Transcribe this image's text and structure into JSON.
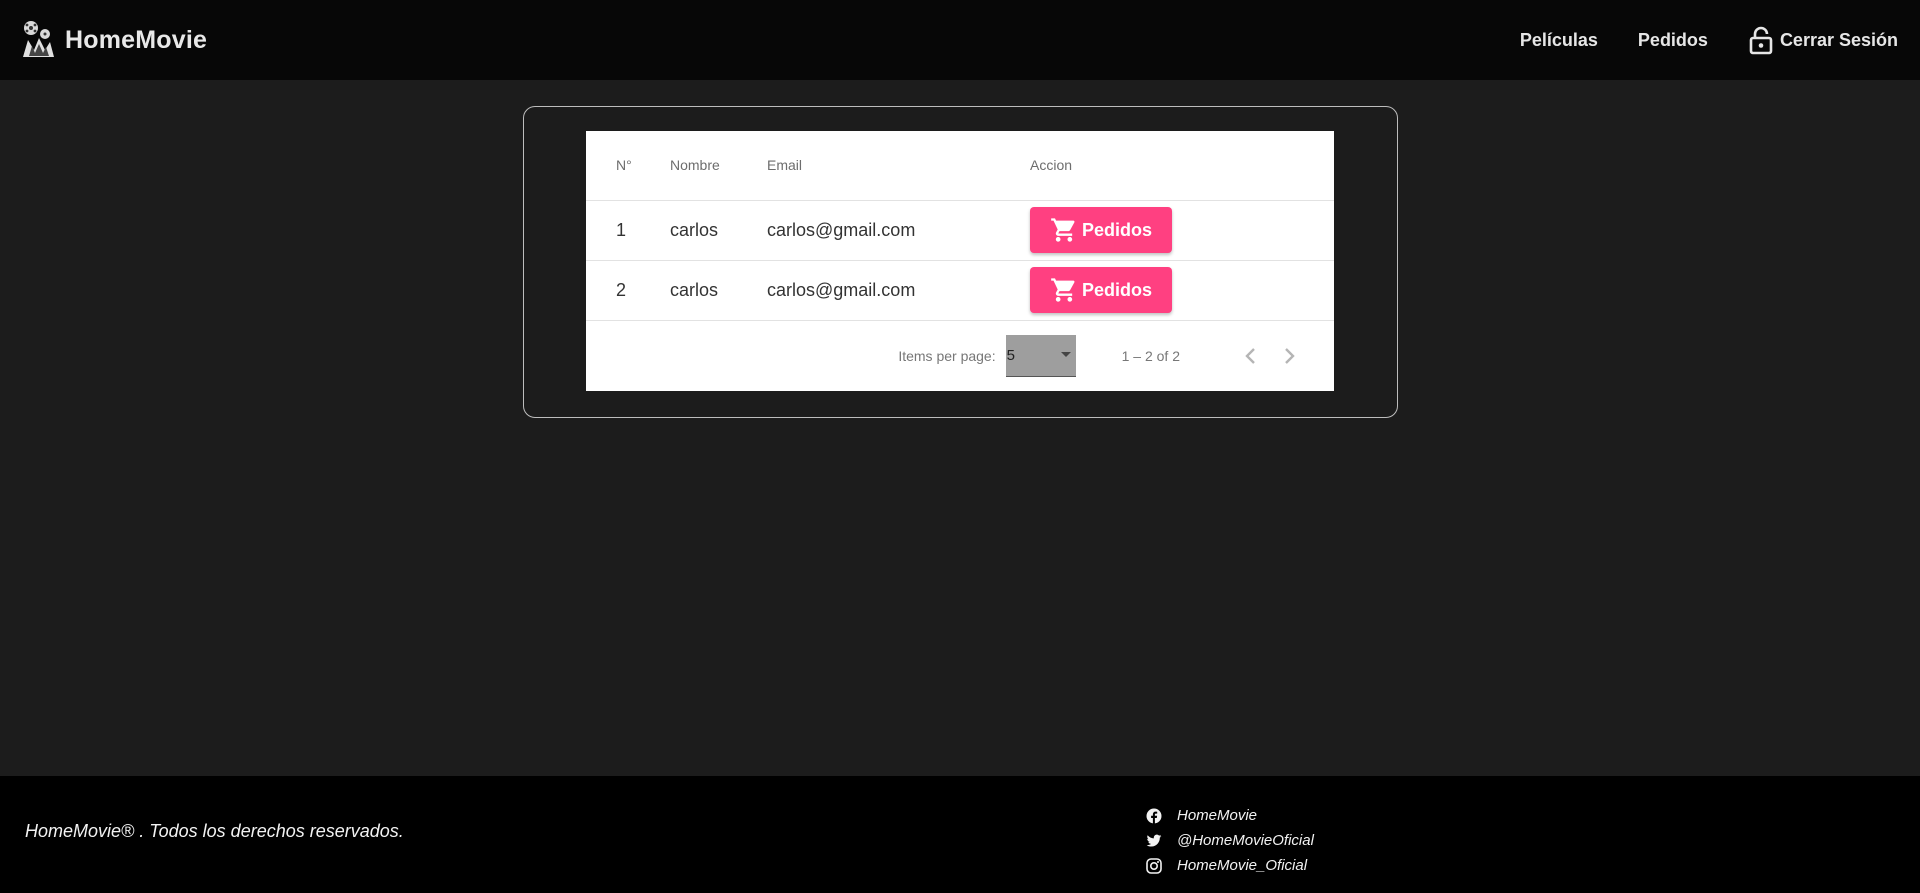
{
  "brand": {
    "title": "HomeMovie"
  },
  "nav": {
    "peliculas": "Películas",
    "pedidos": "Pedidos",
    "logout": "Cerrar Sesión"
  },
  "table": {
    "headers": {
      "num": "N°",
      "nombre": "Nombre",
      "email": "Email",
      "accion": "Accion"
    },
    "rows": [
      {
        "num": "1",
        "nombre": "carlos",
        "email": "carlos@gmail.com",
        "action": "Pedidos"
      },
      {
        "num": "2",
        "nombre": "carlos",
        "email": "carlos@gmail.com",
        "action": "Pedidos"
      }
    ]
  },
  "paginator": {
    "items_per_page_label": "Items per page:",
    "items_per_page_value": "5",
    "range": "1 – 2 of 2"
  },
  "footer": {
    "copyright": "HomeMovie® . Todos los derechos reservados.",
    "facebook": "HomeMovie",
    "twitter": "@HomeMovieOficial",
    "instagram": "HomeMovie_Oficial"
  },
  "colors": {
    "accent": "#ff4081",
    "header_bg": "#070707",
    "page_bg": "#1c1c1c",
    "footer_bg": "#000000"
  },
  "icons": [
    "movie-logo-icon",
    "lock-icon",
    "cart-icon",
    "chevron-left-icon",
    "chevron-right-icon",
    "dropdown-arrow-icon",
    "facebook-icon",
    "twitter-icon",
    "instagram-icon"
  ]
}
